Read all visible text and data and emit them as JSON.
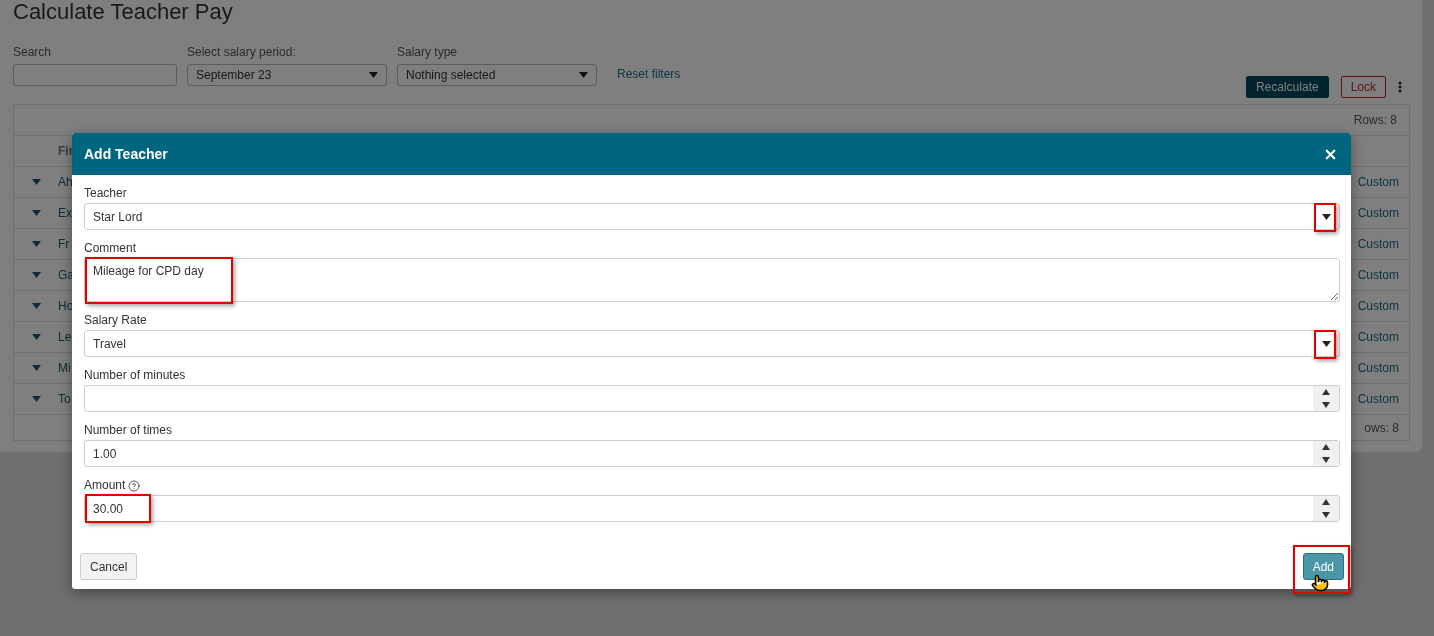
{
  "page": {
    "title": "Calculate Teacher Pay"
  },
  "filters": [
    {
      "kind": "text",
      "label": "Search"
    },
    {
      "kind": "select",
      "label": "Select salary period:",
      "value": "September 23"
    },
    {
      "kind": "select",
      "label": "Salary type",
      "value": "Nothing selected"
    }
  ],
  "reset_link": "Reset filters",
  "actions": [
    {
      "kind": "primary",
      "label": "Recalculate"
    },
    {
      "kind": "danger",
      "label": "Lock"
    }
  ],
  "table": {
    "rows_count_top": "Rows: 8",
    "header_column_1": "Fir",
    "rows": [
      {
        "column_1": "Ah",
        "column_2": "Custom"
      },
      {
        "column_1": "Ex",
        "column_2": "Custom"
      },
      {
        "column_1": "Fr",
        "column_2": "Custom"
      },
      {
        "column_1": "Ga",
        "column_2": "Custom"
      },
      {
        "column_1": "Ho",
        "column_2": "Custom"
      },
      {
        "column_1": "Le",
        "column_2": "Custom"
      },
      {
        "column_1": "Mi",
        "column_2": "Custom"
      },
      {
        "column_1": "To",
        "column_2": "Custom"
      }
    ],
    "rows_count_bottom": "ows: 8"
  },
  "dialog": {
    "title": "Add Teacher",
    "fields": [
      {
        "kind": "select",
        "label": "Teacher",
        "value": "Star Lord",
        "highlighted": true
      },
      {
        "kind": "textarea",
        "label": "Comment",
        "value": "Mileage for CPD day",
        "highlighted": true
      },
      {
        "kind": "select",
        "label": "Salary Rate",
        "value": "Travel",
        "highlighted": true
      },
      {
        "kind": "number",
        "label": "Number of minutes",
        "highlighted": false
      },
      {
        "kind": "number",
        "label": "Number of times",
        "value": "1.00",
        "highlighted": false
      },
      {
        "kind": "number",
        "label": "Amount",
        "value": "30.00",
        "help": true,
        "highlighted": true
      }
    ],
    "buttons": [
      {
        "kind": "secondary",
        "label": "Cancel",
        "highlighted": false
      },
      {
        "kind": "primary",
        "label": "Add",
        "highlighted": true
      }
    ]
  }
}
